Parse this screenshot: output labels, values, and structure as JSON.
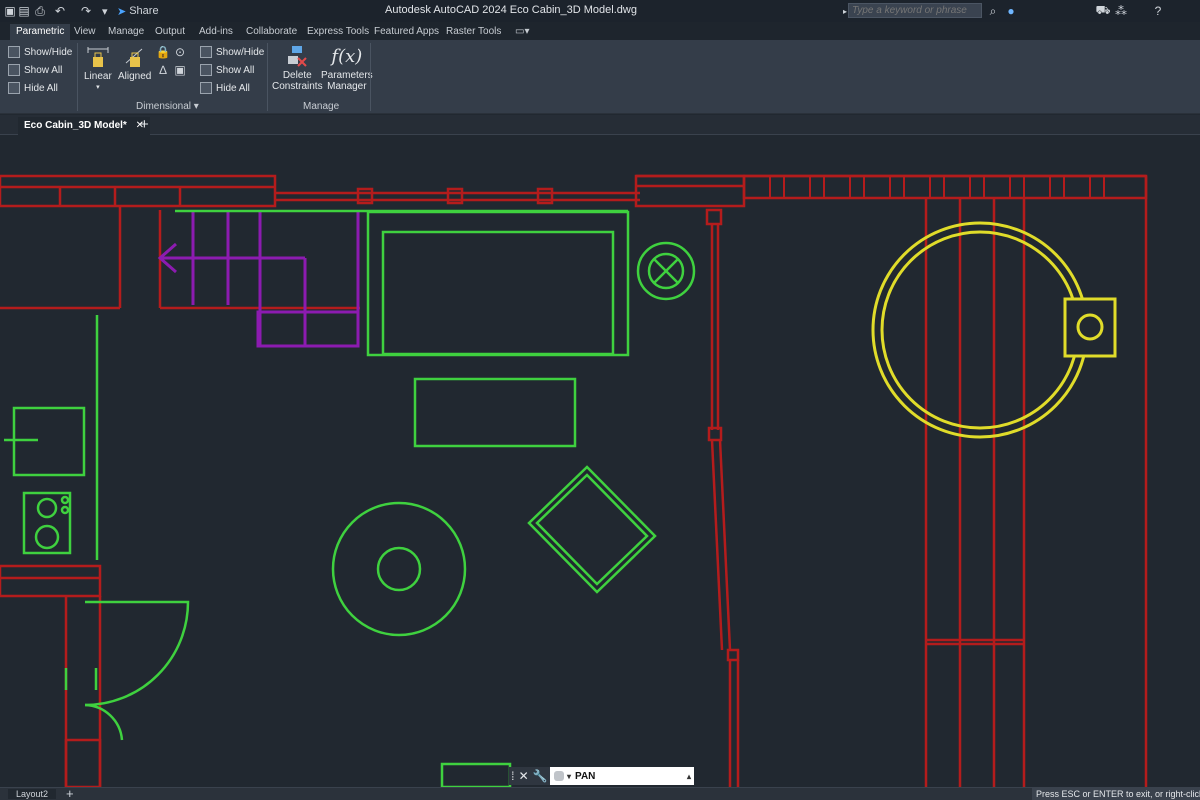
{
  "app": {
    "title": "Autodesk AutoCAD 2024   Eco Cabin_3D Model.dwg",
    "share_label": "Share",
    "search_placeholder": "Type a keyword or phrase"
  },
  "ribbon_tabs": [
    {
      "label": "Parametric",
      "active": true
    },
    {
      "label": "View"
    },
    {
      "label": "Manage"
    },
    {
      "label": "Output"
    },
    {
      "label": "Add-ins"
    },
    {
      "label": "Collaborate"
    },
    {
      "label": "Express Tools"
    },
    {
      "label": "Featured Apps"
    },
    {
      "label": "Raster Tools"
    }
  ],
  "ribbon": {
    "geometric": {
      "show_hide": "Show/Hide",
      "show_all": "Show All",
      "hide_all": "Hide All"
    },
    "dimensional": {
      "linear": "Linear",
      "aligned": "Aligned",
      "show_hide": "Show/Hide",
      "show_all": "Show All",
      "hide_all": "Hide All",
      "panel_label": "Dimensional ▾"
    },
    "manage": {
      "delete_constraints_line1": "Delete",
      "delete_constraints_line2": "Constraints",
      "parameters_manager_line1": "Parameters",
      "parameters_manager_line2": "Manager",
      "panel_label": "Manage"
    }
  },
  "document_tabs": [
    {
      "label": "Eco Cabin_3D Model*"
    }
  ],
  "command_line": {
    "value": "PAN"
  },
  "status_bar": {
    "layout_tab": "Layout2",
    "message": "Press ESC or ENTER to exit, or right-click"
  },
  "colors": {
    "wall": "#b41c1c",
    "furniture": "#3fd13f",
    "stairs": "#8c1bb0",
    "hot_tub": "#e0dc2a",
    "canvas": "#212830"
  },
  "icons": [
    "autocad-logo-icon",
    "save-icon",
    "print-icon",
    "undo-icon",
    "redo-icon",
    "share-icon",
    "search-icon",
    "user-icon",
    "cart-icon",
    "network-icon",
    "help-icon"
  ]
}
